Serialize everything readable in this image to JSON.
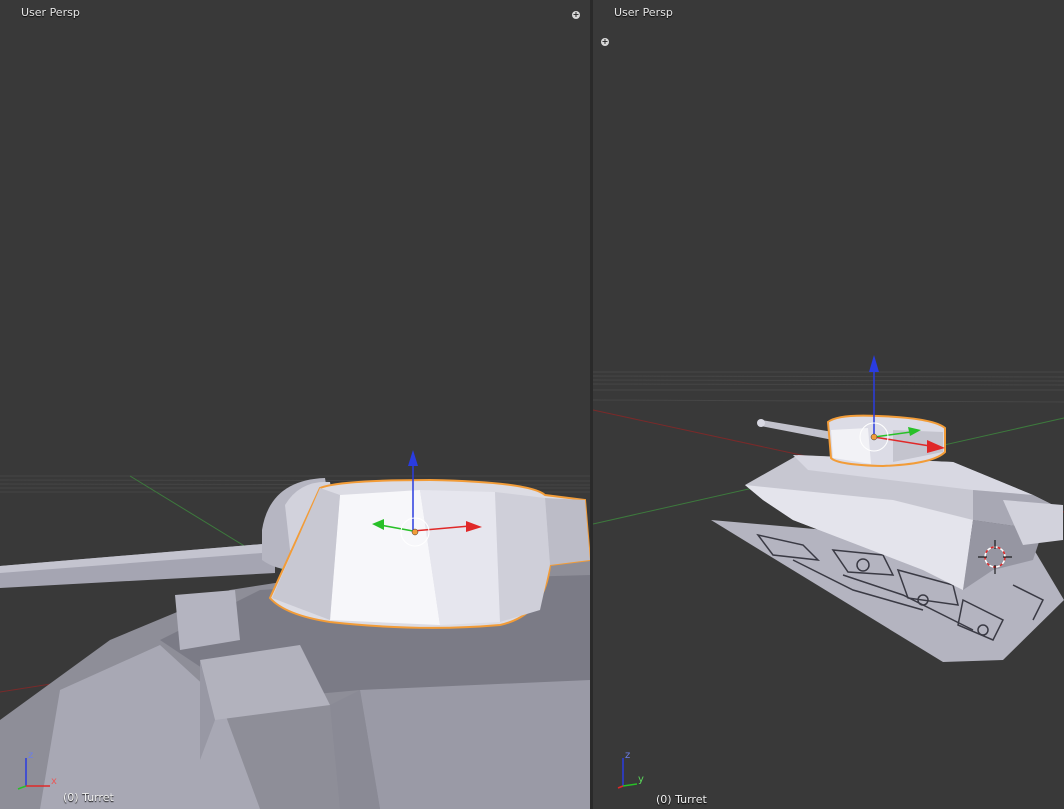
{
  "left_viewport": {
    "title": "User Persp",
    "status": "(0) Turret",
    "axis_labels": {
      "up": "z",
      "right": "x"
    }
  },
  "right_viewport": {
    "title": "User Persp",
    "status": "(0) Turret",
    "axis_labels": {
      "up": "z",
      "right": "y"
    }
  },
  "colors": {
    "background": "#393939",
    "selection_outline": "#f29c38",
    "axis_x": "#e02828",
    "axis_y": "#28c028",
    "axis_z": "#2a3ce0"
  }
}
